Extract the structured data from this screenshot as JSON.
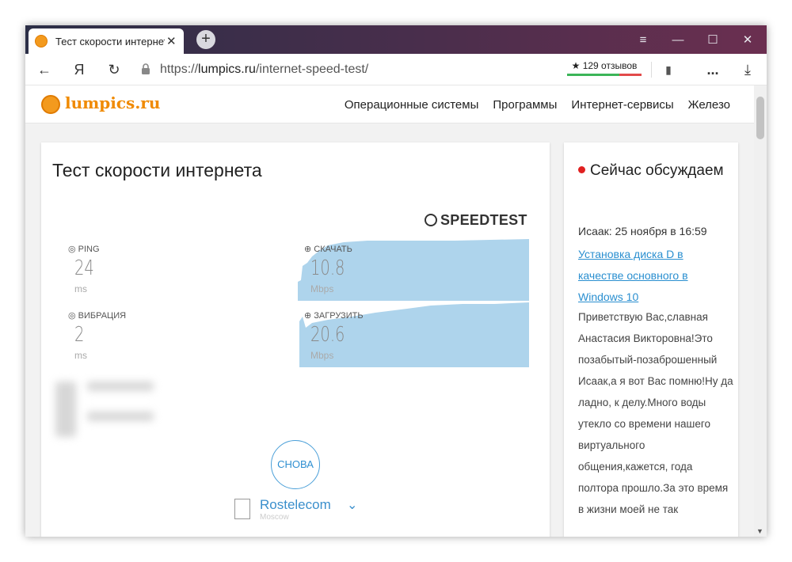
{
  "browser": {
    "tab_title": "Тест скорости интернета",
    "tab_close": "✕",
    "new_tab": "+",
    "menu_icon": "≡",
    "minimize_icon": "—",
    "maximize_icon": "☐",
    "close_icon": "✕",
    "back_icon": "←",
    "yandex_icon": "Я",
    "reload_icon": "↻",
    "url_prefix": "https://",
    "url_domain": "lumpics.ru",
    "url_path": "/internet-speed-test/",
    "reviews": "★ 129 отзывов",
    "bookmark_icon": "▮",
    "more_icon": "...",
    "download_icon": "⤓"
  },
  "site": {
    "logo": "lumpics.ru",
    "nav": [
      "Операционные системы",
      "Программы",
      "Интернет-сервисы",
      "Железо"
    ]
  },
  "speedtest": {
    "title": "Тест скорости интернета",
    "brand": "SPEEDTEST",
    "ping": {
      "label": "PING",
      "value": "24",
      "unit": "ms"
    },
    "jitter": {
      "label": "ВИБРАЦИЯ",
      "value": "2",
      "unit": "ms"
    },
    "download": {
      "label": "СКАЧАТЬ",
      "value": "10.8",
      "unit": "Mbps"
    },
    "upload": {
      "label": "ЗАГРУЗИТЬ",
      "value": "20.6",
      "unit": "Mbps"
    },
    "again_button": "СНОВА",
    "isp": {
      "name": "Rostelecom",
      "location": "Moscow"
    }
  },
  "sidebar": {
    "heading": "Сейчас обсуждаем",
    "author": "Исаак: 25 ноября в 16:59",
    "post_link": "Установка диска D в качестве основного в Windows 10",
    "comment": "Приветствую Вас,славная Анастасия Викторовна!Это позабытый-позаброшенный Исаак,а я вот Вас помню!Ну да ладно, к делу.Много воды утекло со времени нашего виртуального общения,кажется, года полтора прошло.За это время в жизни моей не так"
  },
  "colors": {
    "accent": "#f08a00",
    "link": "#2a8fd0",
    "chart_fill": "#aed4ec"
  }
}
